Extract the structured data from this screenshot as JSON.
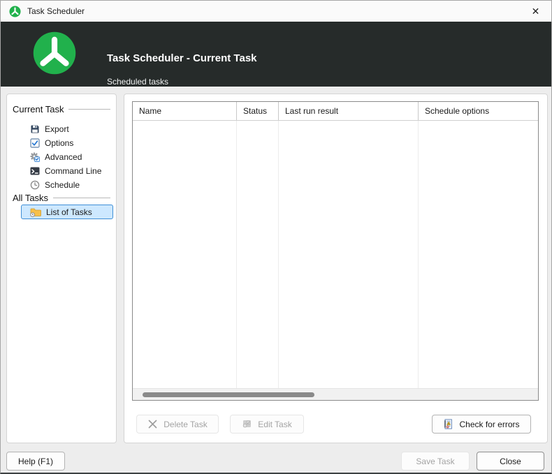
{
  "window": {
    "title": "Task Scheduler"
  },
  "icons": {
    "close": "✕"
  },
  "header": {
    "title": "Task Scheduler - Current Task",
    "subtitle": "Scheduled tasks"
  },
  "sidebar": {
    "groups": [
      {
        "label": "Current Task",
        "items": [
          {
            "label": "Export",
            "icon": "floppy-disk-icon"
          },
          {
            "label": "Options",
            "icon": "checkbox-icon"
          },
          {
            "label": "Advanced",
            "icon": "gear-check-icon"
          },
          {
            "label": "Command Line",
            "icon": "terminal-icon"
          },
          {
            "label": "Schedule",
            "icon": "clock-icon"
          }
        ]
      },
      {
        "label": "All Tasks",
        "items": [
          {
            "label": "List of Tasks",
            "icon": "folder-clock-icon",
            "selected": true
          }
        ]
      }
    ]
  },
  "table": {
    "columns": [
      "Name",
      "Status",
      "Last run result",
      "Schedule options"
    ],
    "rows": []
  },
  "actions": {
    "delete_task": "Delete Task",
    "edit_task": "Edit Task",
    "check_for_errors": "Check for errors"
  },
  "footer": {
    "help": "Help (F1)",
    "save_task": "Save Task",
    "close": "Close"
  },
  "colors": {
    "accent_green": "#21b14c",
    "header_bg": "#262b2a",
    "selection_bg": "#cde8ff",
    "selection_border": "#3f8fd6"
  }
}
